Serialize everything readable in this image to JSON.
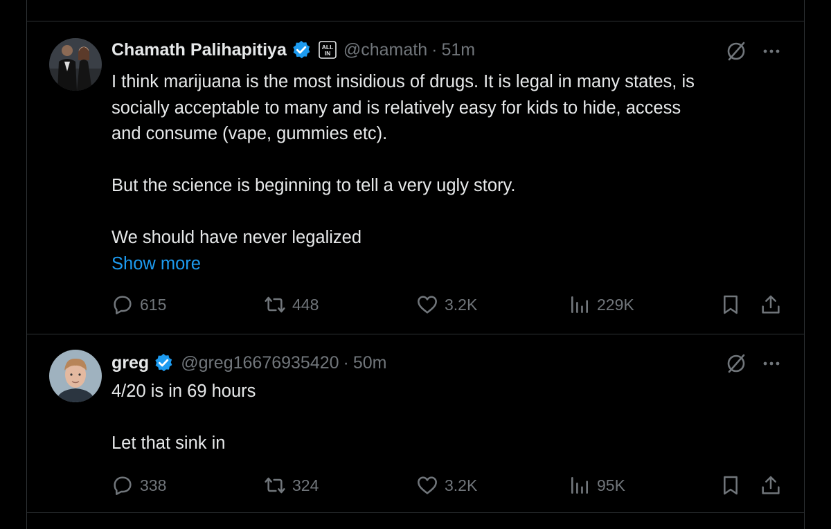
{
  "colors": {
    "background": "#000000",
    "text": "#e7e9ea",
    "muted": "#71767b",
    "link": "#1d9bf0",
    "verified": "#1d9bf0",
    "border": "#2f3336"
  },
  "tweets": [
    {
      "author": {
        "name": "Chamath Palihapitiya",
        "handle": "@chamath",
        "verified": true,
        "affiliate_badge": "all-in-badge-icon"
      },
      "separator": "·",
      "time": "51m",
      "lines": [
        "I think marijuana is the most insidious of drugs. It is legal in many states, is",
        "socially acceptable to many and is relatively easy for kids to hide, access",
        "and consume (vape, gummies etc).",
        "",
        "But the science is beginning to tell a very ugly story.",
        "",
        "We should have never legalized"
      ],
      "show_more": "Show more",
      "stats": {
        "replies": "615",
        "reposts": "448",
        "likes": "3.2K",
        "views": "229K"
      }
    },
    {
      "author": {
        "name": "greg",
        "handle": "@greg16676935420",
        "verified": true
      },
      "separator": "·",
      "time": "50m",
      "lines": [
        "4/20 is in 69 hours",
        "",
        "Let that sink in"
      ],
      "stats": {
        "replies": "338",
        "reposts": "324",
        "likes": "3.2K",
        "views": "95K"
      }
    }
  ],
  "icons": {
    "reply": "reply-icon",
    "repost": "repost-icon",
    "like": "heart-icon",
    "views": "views-icon",
    "bookmark": "bookmark-icon",
    "share": "share-icon",
    "grok": "grok-icon",
    "more": "more-icon"
  }
}
